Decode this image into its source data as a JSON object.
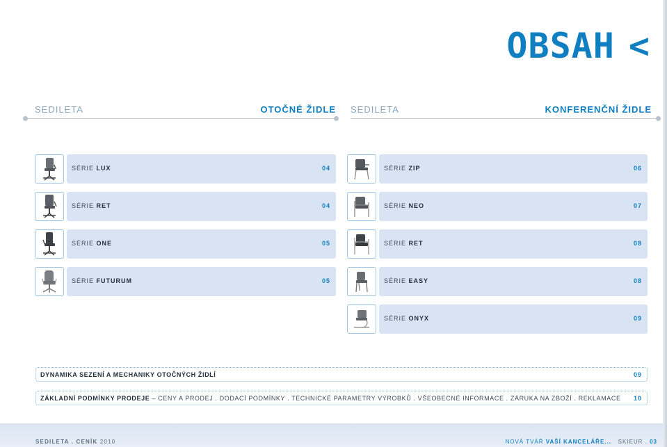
{
  "title": "OBSAH",
  "title_chevron": "<",
  "left_column": {
    "brand": "SEDILETA",
    "category": "OTOČNÉ ŽIDLE",
    "items": [
      {
        "prefix": "SÉRIE",
        "name": "LUX",
        "page": "04",
        "icon": "office-swivel-chair-icon"
      },
      {
        "prefix": "SÉRIE",
        "name": "RET",
        "page": "04",
        "icon": "office-swivel-chair-icon"
      },
      {
        "prefix": "SÉRIE",
        "name": "ONE",
        "page": "05",
        "icon": "office-swivel-chair-icon"
      },
      {
        "prefix": "SÉRIE",
        "name": "FUTURUM",
        "page": "05",
        "icon": "executive-chair-icon"
      }
    ]
  },
  "right_column": {
    "brand": "SEDILETA",
    "category": "KONFERENČNÍ ŽIDLE",
    "items": [
      {
        "prefix": "SÉRIE",
        "name": "ZIP",
        "page": "06",
        "icon": "conference-chair-icon"
      },
      {
        "prefix": "SÉRIE",
        "name": "NEO",
        "page": "07",
        "icon": "conference-chair-icon"
      },
      {
        "prefix": "SÉRIE",
        "name": "RET",
        "page": "08",
        "icon": "conference-chair-icon"
      },
      {
        "prefix": "SÉRIE",
        "name": "EASY",
        "page": "08",
        "icon": "conference-chair-icon"
      },
      {
        "prefix": "SÉRIE",
        "name": "ONYX",
        "page": "09",
        "icon": "cantilever-chair-icon"
      }
    ]
  },
  "extra": [
    {
      "bold": "DYNAMIKA SEZENÍ A MECHANIKY OTOČNÝCH ŽIDLÍ",
      "text": "",
      "page": "09"
    },
    {
      "bold": "ZÁKLADNÍ PODMÍNKY PRODEJE",
      "text": " – CENY A PRODEJ . DODACÍ PODMÍNKY . TECHNICKÉ PARAMETRY VÝROBKŮ . VŠEOBECNÉ INFORMACE . ZÁRUKA NA ZBOŽÍ . REKLAMACE",
      "page": "10"
    }
  ],
  "footer": {
    "left_bold": "SEDILETA . CENÍK",
    "left_year": " 2010",
    "right_prefix": "NOVÁ TVÁŘ ",
    "right_bold": "VAŠÍ KANCELÁŘE...",
    "right_brand": "SKIEUR",
    "right_sep": " . ",
    "page_number": "03"
  },
  "colors": {
    "accent": "#0f7fc1",
    "row_fill": "#d8e4f3",
    "footer_fill": "#dbe5f2"
  }
}
